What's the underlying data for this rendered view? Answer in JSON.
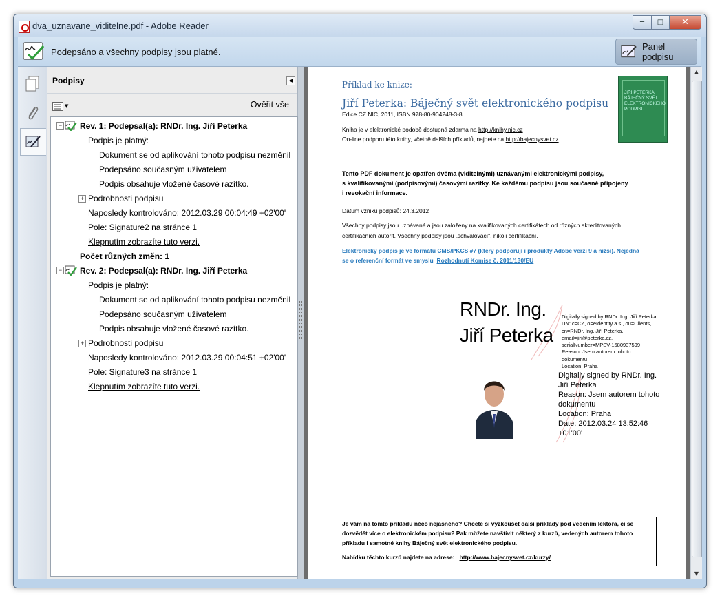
{
  "window": {
    "title": "dva_uznavane_viditelne.pdf - Adobe Reader"
  },
  "signature_bar": {
    "message": "Podepsáno a všechny podpisy jsou platné.",
    "panel_button": "Panel podpisu"
  },
  "signatures_panel": {
    "title": "Podpisy",
    "verify_all": "Ověřit vše",
    "revisions": [
      {
        "header": "Rev. 1: Podepsal(a): RNDr. Ing. Jiří Peterka",
        "valid_label": "Podpis je platný:",
        "valid_items": [
          "Dokument se od aplikování tohoto podpisu nezměnil",
          "Podepsáno současným uživatelem",
          "Podpis obsahuje vložené časové razítko."
        ],
        "details": "Podrobnosti podpisu",
        "last_checked": "Naposledy kontrolováno: 2012.03.29 00:04:49 +02'00'",
        "field": "Pole: Signature2 na stránce 1",
        "view_version": "Klepnutím zobrazíte tuto verzi."
      },
      {
        "header": "Rev. 2: Podepsal(a): RNDr. Ing. Jiří Peterka",
        "valid_label": "Podpis je platný:",
        "valid_items": [
          "Dokument se od aplikování tohoto podpisu nezměnil",
          "Podepsáno současným uživatelem",
          "Podpis obsahuje vložené časové razítko."
        ],
        "details": "Podrobnosti podpisu",
        "last_checked": "Naposledy kontrolováno: 2012.03.29 00:04:51 +02'00'",
        "field": "Pole: Signature3 na stránce 1",
        "view_version": "Klepnutím zobrazíte tuto verzi."
      }
    ],
    "changes_count": "Počet různých změn: 1"
  },
  "document": {
    "kicker": "Příklad ke knize:",
    "title": "Jiří Peterka: Báječný svět elektronického podpisu",
    "edition": "Edice CZ.NIC, 2011, ISBN 978-80-904248-3-8",
    "line1_prefix": "Kniha je v elektronické podobě dostupná zdarma na",
    "line1_link": "http://knihy.nic.cz",
    "line2_prefix": "On-line podporu této knihy, včetně dalších příkladů, najdete na",
    "line2_link": "http://bajecnysvet.cz",
    "book_cover_text": "JIŘÍ PETERKA BÁJEČNÝ SVĚT ELEKTRONICKÉHO PODPISU",
    "intro1": "Tento PDF dokument je opatřen dvěma (viditelnými) uznávanými elektronickými podpisy,",
    "intro2": "s kvalifikovanými (podpisovými) časovými razítky. Ke každému podpisu jsou současně připojeny",
    "intro3": "i revokační informace.",
    "date_line": "Datum vzniku podpisů: 24.3.2012",
    "cert1": "Všechny podpisy jsou uznávané a jsou založeny na kvalifikovaných certifikátech od různých akreditovaných",
    "cert2": "certifikačních autorit. Všechny podpisy jsou „schvalovací\", nikoli certifikační.",
    "blue1": "Elektronický podpis je ve formátu CMS/PKCS #7 (který podporují i produkty Adobe verzí 9 a nižší). Nejedná",
    "blue2_prefix": "se o referenční formát ve smyslu",
    "blue2_link": "Rozhodnutí Komise č. 2011/130/EU",
    "sig1_name_line1": "RNDr. Ing.",
    "sig1_name_line2": "Jiří Peterka",
    "sig1_details": [
      "Digitally signed by RNDr. Ing. Jiří Peterka",
      "DN: c=CZ, o=eIdentity a.s., ou=Clients,",
      "cn=RNDr. Ing. Jiří Peterka,",
      "email=jiri@peterka.cz,",
      "serialNumber=MPSV-1680937599",
      "Reason: Jsem autorem tohoto",
      "dokumentu",
      "Location: Praha"
    ],
    "sig2_details": [
      "Digitally signed by RNDr. Ing.",
      "Jiří Peterka",
      "Reason: Jsem autorem tohoto",
      "dokumentu",
      "Location: Praha",
      "Date: 2012.03.24 13:52:46",
      "+01'00'"
    ],
    "box1": "Je vám na tomto příkladu něco nejasného? Chcete si vyzkoušet další příklady pod vedením lektora, či se",
    "box2": "dozvědět více o elektronickém podpisu? Pak můžete navštívit některý z kurzů, vedených autorem tohoto",
    "box3": "příkladu i samotné knihy Báječný svět elektronického podpisu.",
    "box4_prefix": "Nabídku těchto kurzů najdete na adrese:",
    "box4_link": "http://www.bajecnysvet.cz/kurzy/"
  },
  "colors": {
    "title_blue": "#3b6aa0",
    "link_blue": "#2a7bbd",
    "panel_bg": "#ececec",
    "chrome": "#bcd3ea"
  }
}
